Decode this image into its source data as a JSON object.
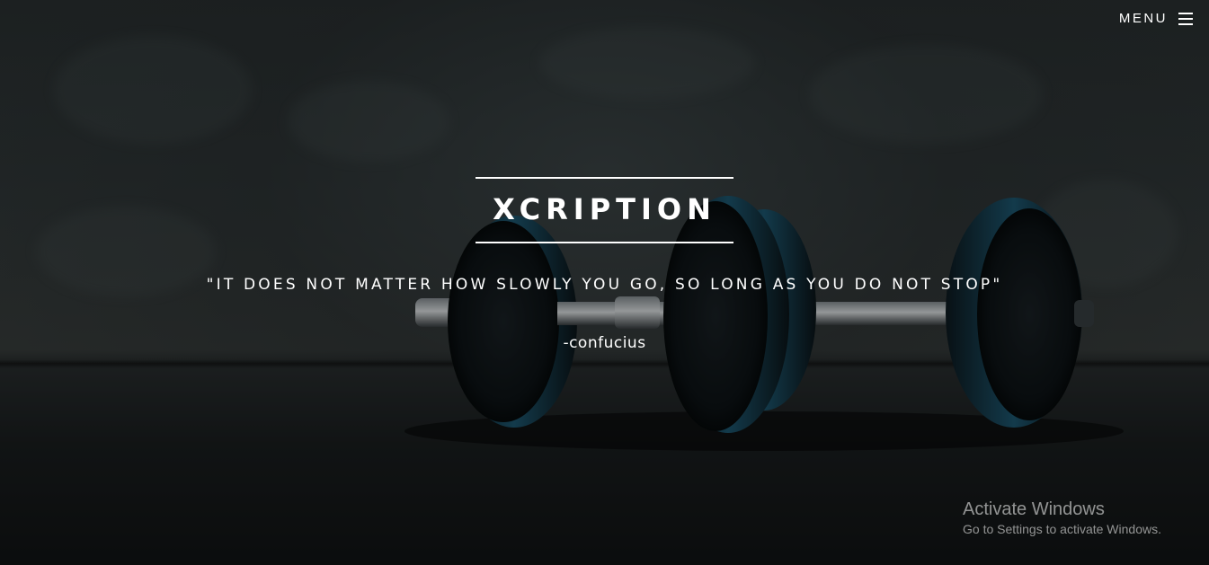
{
  "nav": {
    "menu_label": "MENU",
    "menu_icon": "hamburger-icon"
  },
  "hero": {
    "title": "XCRIPTION",
    "quote": "\"IT DOES NOT MATTER HOW SLOWLY YOU GO, SO LONG AS YOU DO NOT STOP\"",
    "author": "-confucius",
    "background_image": "dumbbell-photo"
  },
  "watermark": {
    "title": "Activate Windows",
    "subtitle": "Go to Settings to activate Windows."
  },
  "colors": {
    "text": "#ffffff",
    "plate_accent": "#1f5f7a",
    "background": "#2b3233"
  }
}
